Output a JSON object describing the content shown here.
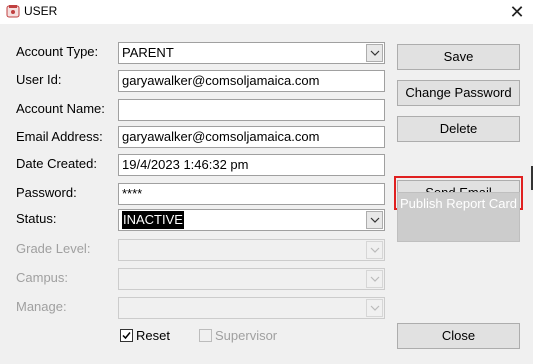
{
  "window": {
    "title": "USER",
    "icon": "user-app-icon",
    "close_glyph": "✕"
  },
  "form": {
    "account_type": {
      "label": "Account Type:",
      "value": "PARENT"
    },
    "user_id": {
      "label": "User Id:",
      "value": "garyawalker@comsoljamaica.com"
    },
    "account_name": {
      "label": "Account Name:",
      "value": ""
    },
    "email_address": {
      "label": "Email Address:",
      "value": "garyawalker@comsoljamaica.com"
    },
    "date_created": {
      "label": "Date Created:",
      "value": "19/4/2023 1:46:32 pm"
    },
    "password": {
      "label": "Password:",
      "value": "****"
    },
    "status": {
      "label": "Status:",
      "value": "INACTIVE"
    },
    "grade_level": {
      "label": "Grade Level:",
      "value": ""
    },
    "campus": {
      "label": "Campus:",
      "value": ""
    },
    "manage": {
      "label": "Manage:",
      "value": ""
    }
  },
  "checkboxes": {
    "reset": {
      "label": "Reset",
      "checked": true
    },
    "supervisor": {
      "label": "Supervisor",
      "checked": false
    }
  },
  "buttons": {
    "save": "Save",
    "change_password": "Change Password",
    "delete": "Delete",
    "send_email": "Send Email",
    "publish_report_card": "Publish Report Card",
    "close": "Close"
  },
  "colors": {
    "highlight": "#e02020",
    "selection": "#000000"
  }
}
